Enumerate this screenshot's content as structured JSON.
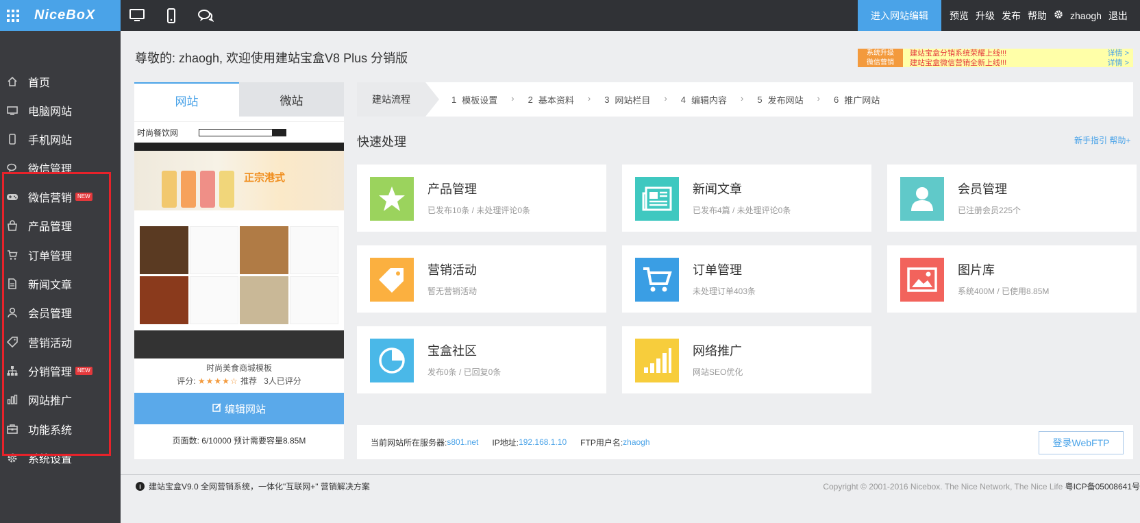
{
  "app": {
    "logo": "NiceBoX",
    "accent_color": "#4aa3e8"
  },
  "topbar": {
    "device_icons": [
      "desktop-icon",
      "mobile-icon",
      "chat-icon"
    ],
    "editor_button": "进入网站编辑",
    "links": [
      "预览",
      "升级",
      "发布",
      "帮助"
    ],
    "username": "zhaogh",
    "logout": "退出"
  },
  "sidebar": {
    "items": [
      {
        "label": "首页",
        "icon": "home-icon"
      },
      {
        "label": "电脑网站",
        "icon": "desktop-icon"
      },
      {
        "label": "手机网站",
        "icon": "mobile-icon"
      },
      {
        "label": "微信管理",
        "icon": "chat-icon"
      },
      {
        "label": "微信营销",
        "icon": "gamepad-icon",
        "badge": "NEW"
      },
      {
        "label": "产品管理",
        "icon": "bag-icon"
      },
      {
        "label": "订单管理",
        "icon": "cart-icon"
      },
      {
        "label": "新闻文章",
        "icon": "document-icon"
      },
      {
        "label": "会员管理",
        "icon": "user-icon"
      },
      {
        "label": "营销活动",
        "icon": "tag-icon"
      },
      {
        "label": "分销管理",
        "icon": "sitemap-icon",
        "badge": "NEW"
      },
      {
        "label": "网站推广",
        "icon": "bar-chart-icon"
      },
      {
        "label": "功能系统",
        "icon": "toolbox-icon"
      },
      {
        "label": "系统设置",
        "icon": "gear-icon"
      }
    ],
    "highlight_color": "#e8222a"
  },
  "greeting": "尊敬的: zhaogh, 欢迎使用建站宝盒V8 Plus 分销版",
  "notice": [
    {
      "tag": "系统升级",
      "text": "建站宝盒分销系统荣耀上线!!!",
      "more": "详情 >"
    },
    {
      "tag": "微信营销",
      "text": "建站宝盒微信营销全新上线!!!",
      "more": "详情 >"
    }
  ],
  "preview": {
    "tabs": [
      "网站",
      "微站"
    ],
    "thumb_site_title": "时尚餐饮网",
    "thumb_banner_text": "正宗港式",
    "template_name": "时尚美食商城模板",
    "rating_label": "评分:",
    "stars": "★★★★☆",
    "rating_value": 4,
    "recommend": "推荐",
    "rated_count": "3人已评分",
    "edit_button": "编辑网站",
    "page_stats": "页面数: 6/10000 预计需要容量8.85M"
  },
  "workflow": {
    "title": "建站流程",
    "steps": [
      {
        "num": "1",
        "label": "模板设置"
      },
      {
        "num": "2",
        "label": "基本资料"
      },
      {
        "num": "3",
        "label": "网站栏目"
      },
      {
        "num": "4",
        "label": "编辑内容"
      },
      {
        "num": "5",
        "label": "发布网站"
      },
      {
        "num": "6",
        "label": "推广网站"
      }
    ]
  },
  "quick": {
    "title": "快速处理",
    "links": "新手指引  帮助+",
    "cards": [
      {
        "title": "产品管理",
        "desc": "已发布10条 / 未处理评论0条",
        "icon": "star-icon",
        "color": "#9bd35d"
      },
      {
        "title": "新闻文章",
        "desc": "已发布4篇 / 未处理评论0条",
        "icon": "newspaper-icon",
        "color": "#3fc8c0"
      },
      {
        "title": "会员管理",
        "desc": "已注册会员225个",
        "icon": "user-icon",
        "color": "#60c9c9"
      },
      {
        "title": "营销活动",
        "desc": "暂无营销活动",
        "icon": "tag-icon",
        "color": "#fbb040"
      },
      {
        "title": "订单管理",
        "desc": "未处理订单403条",
        "icon": "cart-icon",
        "color": "#3a9ee4"
      },
      {
        "title": "图片库",
        "desc": "系统400M / 已使用8.85M",
        "icon": "image-icon",
        "color": "#f2635c"
      },
      {
        "title": "宝盒社区",
        "desc": "发布0条 / 已回复0条",
        "icon": "pie-chart-icon",
        "color": "#4ab8e8"
      },
      {
        "title": "网络推广",
        "desc": "网站SEO优化",
        "icon": "signal-icon",
        "color": "#f7cd3c"
      }
    ]
  },
  "server": {
    "server_label": "当前网站所在服务器:",
    "server_value": "s801.net",
    "ip_label": "IP地址:",
    "ip_value": "192.168.1.10",
    "ftp_label": "FTP用户名:",
    "ftp_value": "zhaogh",
    "webftp_button": "登录WebFTP"
  },
  "footer": {
    "left": "建站宝盒V9.0 全网营销系统，一体化\"互联网+\" 营销解决方案",
    "copyright": "Copyright © 2001-2016 Nicebox. The Nice Network, The Nice Life",
    "icp": "粤ICP备05008641号"
  }
}
